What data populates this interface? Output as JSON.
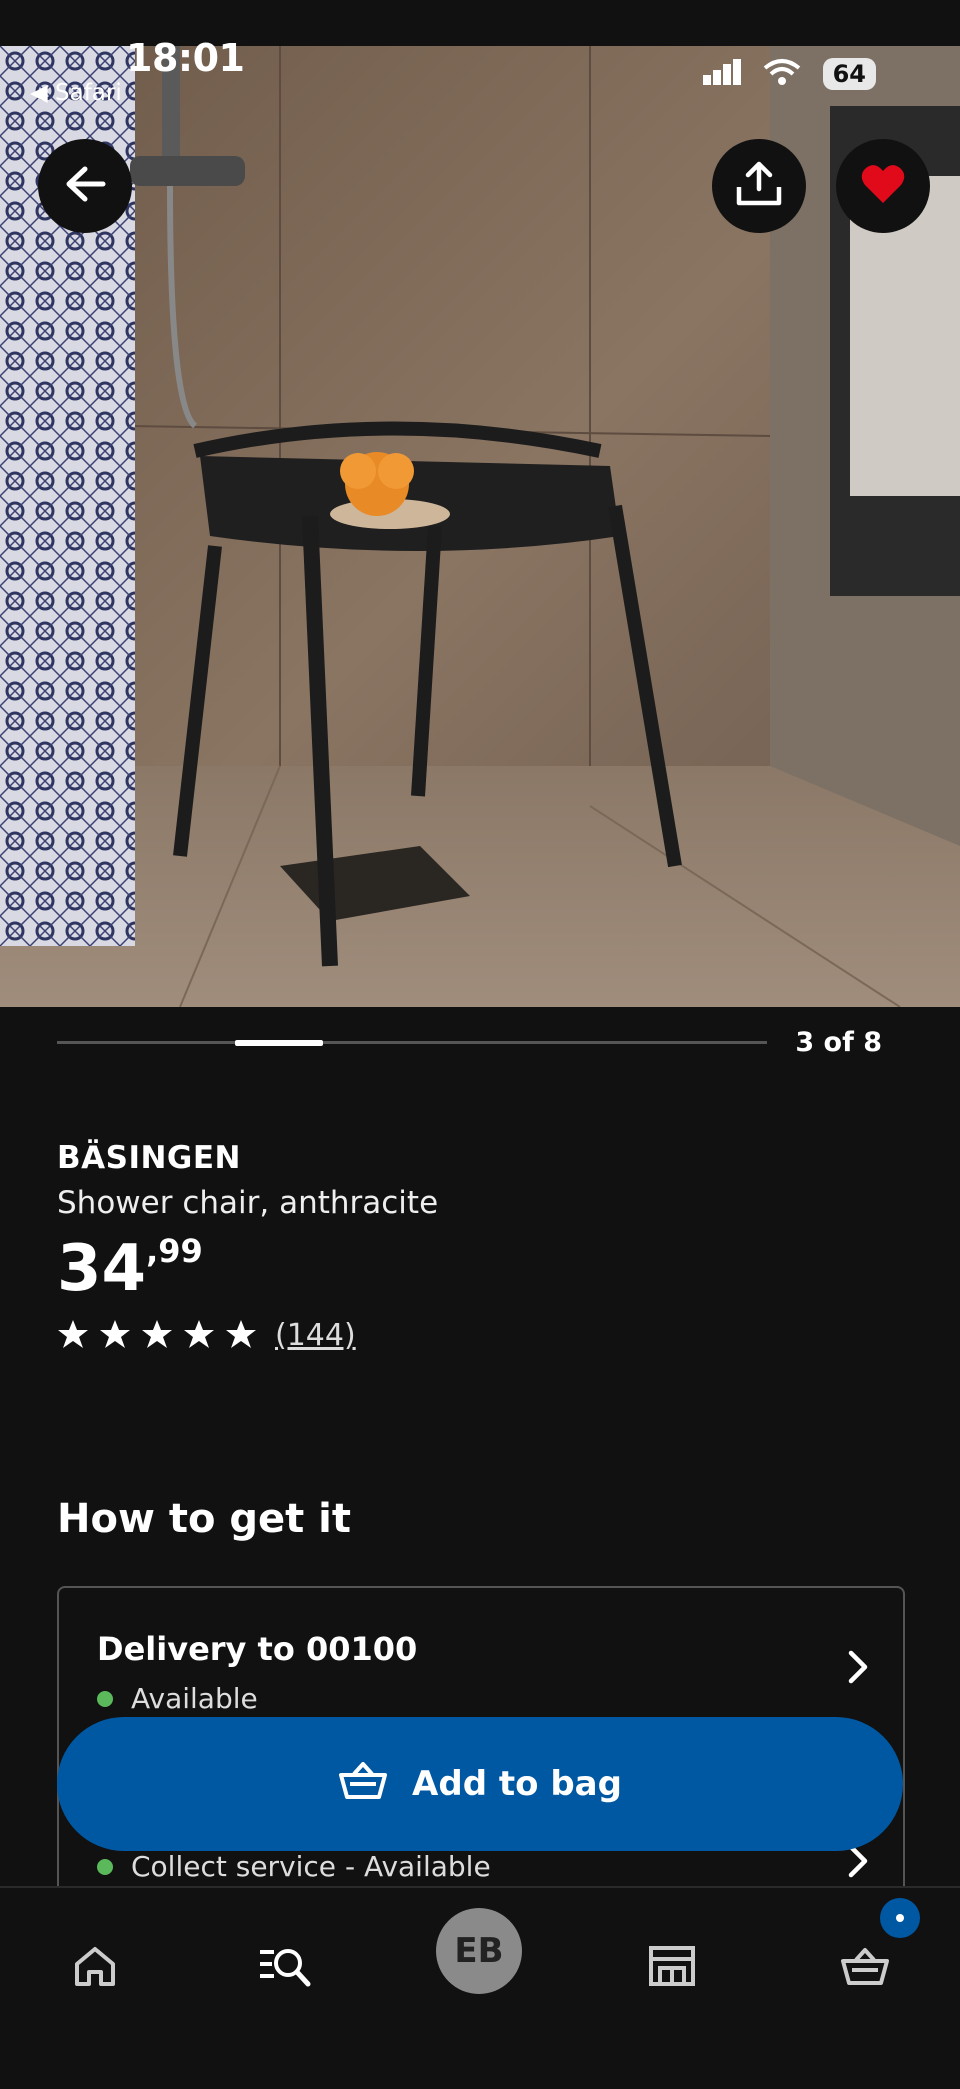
{
  "status_bar": {
    "time": "18:01",
    "back_app": "◀ Safari",
    "battery": "64"
  },
  "gallery": {
    "counter": "3 of 8",
    "current": 3,
    "total": 8
  },
  "product": {
    "name": "BÄSINGEN",
    "description": "Shower chair, anthracite",
    "price_integer": "34",
    "price_separator": ",",
    "price_decimal": "99",
    "rating_stars": 5,
    "rating_count": "(144)"
  },
  "how_to_get": {
    "title": "How to get it",
    "delivery_title": "Delivery to 00100",
    "delivery_status": "Available",
    "collect_status": "Collect service - Available"
  },
  "add_to_bag": {
    "label": "Add to bag"
  },
  "bottom_nav": {
    "avatar_initials": "EB"
  },
  "colors": {
    "background": "#111111",
    "accent_blue": "#0058a3",
    "favorite_red": "#e00a1b",
    "available_green": "#5bb85b"
  },
  "icons": [
    "back-arrow-icon",
    "share-icon",
    "heart-icon",
    "star-icon",
    "chevron-right-icon",
    "basket-icon",
    "home-icon",
    "search-list-icon",
    "store-icon"
  ]
}
